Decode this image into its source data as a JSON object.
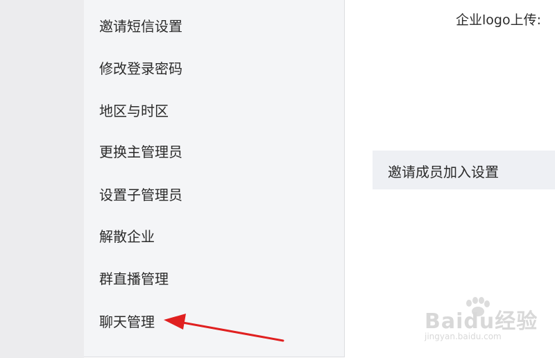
{
  "sidebar": {
    "items": [
      {
        "label": "邀请短信设置"
      },
      {
        "label": "修改登录密码"
      },
      {
        "label": "地区与时区"
      },
      {
        "label": "更换主管理员"
      },
      {
        "label": "设置子管理员"
      },
      {
        "label": "解散企业"
      },
      {
        "label": "群直播管理"
      },
      {
        "label": "聊天管理"
      }
    ]
  },
  "main": {
    "logo_upload_label": "企业logo上传:",
    "invite_members_label": "邀请成员加入设置"
  },
  "annotation": {
    "arrow_color": "#e02020"
  },
  "watermark": {
    "brand": "Baidu经验",
    "url": "jingyan.baidu.com"
  },
  "colors": {
    "sidebar_bg": "#f4f5f7",
    "gutter_bg": "#ececee",
    "panel_bg": "#eef0f4",
    "text": "#2b2b2b"
  }
}
